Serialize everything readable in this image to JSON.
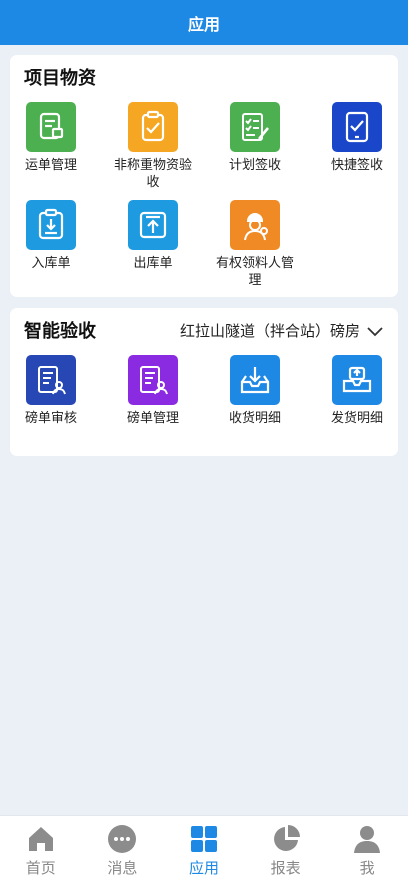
{
  "header": {
    "title": "应用"
  },
  "materials": {
    "title": "项目物资",
    "items": [
      {
        "label": "运单管理",
        "icon": "waybill-icon",
        "color": "#4caf50"
      },
      {
        "label": "非称重物资验收",
        "icon": "clipboard-check-icon",
        "color": "#f5a623"
      },
      {
        "label": "计划签收",
        "icon": "checklist-pen-icon",
        "color": "#4caf50"
      },
      {
        "label": "快捷签收",
        "icon": "tablet-check-icon",
        "color": "#1a47c9"
      },
      {
        "label": "入库单",
        "icon": "inbound-clipboard-icon",
        "color": "#1e9be0"
      },
      {
        "label": "出库单",
        "icon": "outbound-icon",
        "color": "#1e9be0"
      },
      {
        "label": "有权领料人管理",
        "icon": "worker-avatar-icon",
        "color": "#f08a24"
      }
    ]
  },
  "acceptance": {
    "title": "智能验收",
    "site": "红拉山隧道（拌合站）磅房",
    "items": [
      {
        "label": "磅单审核",
        "icon": "weigh-review-icon",
        "color": "#2747b5"
      },
      {
        "label": "磅单管理",
        "icon": "weigh-manage-icon",
        "color": "#8a2be2"
      },
      {
        "label": "收货明细",
        "icon": "receive-tray-icon",
        "color": "#1e88e5"
      },
      {
        "label": "发货明细",
        "icon": "ship-box-icon",
        "color": "#1e88e5"
      }
    ]
  },
  "tabbar": {
    "active": "应用",
    "tabs": [
      {
        "label": "首页",
        "icon": "home-icon"
      },
      {
        "label": "消息",
        "icon": "message-icon"
      },
      {
        "label": "应用",
        "icon": "apps-icon"
      },
      {
        "label": "报表",
        "icon": "report-icon"
      },
      {
        "label": "我",
        "icon": "user-icon"
      }
    ]
  },
  "colors": {
    "primary": "#1e88e5",
    "inactive": "#888888",
    "background": "#eaf0f5"
  }
}
